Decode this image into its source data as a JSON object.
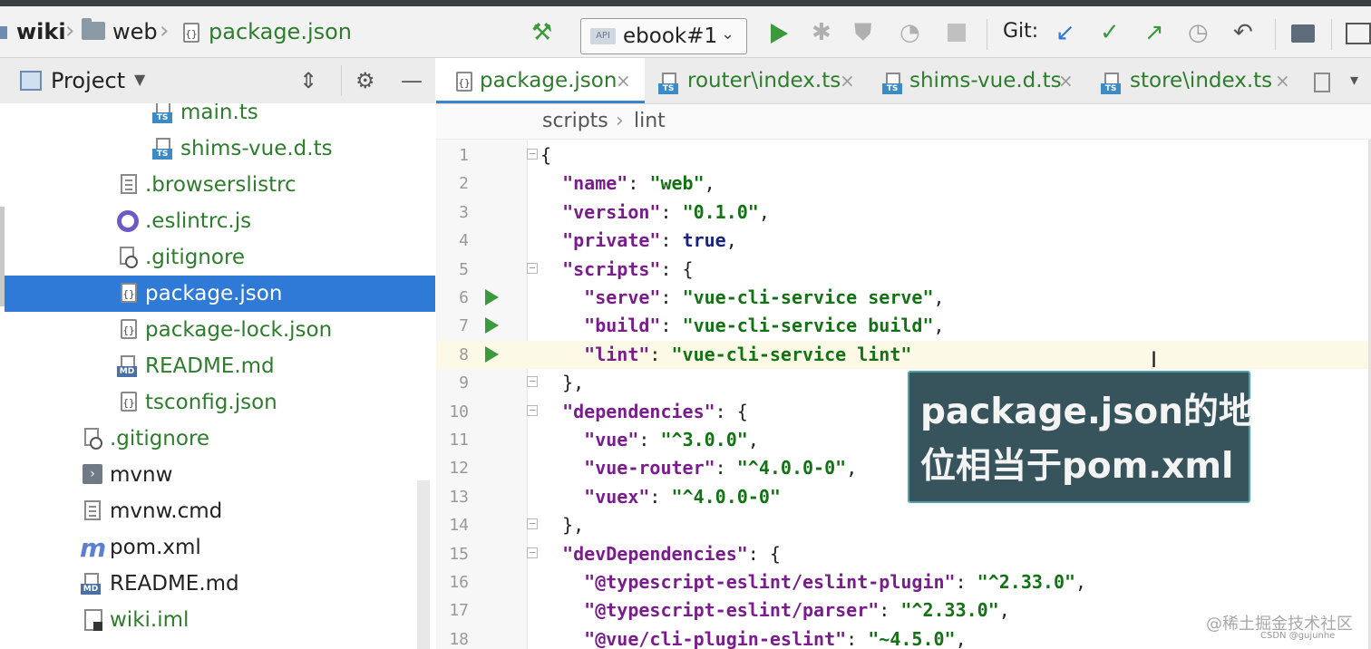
{
  "navbar": {
    "crumbs": [
      "wiki",
      "web",
      "package.json"
    ],
    "run_config": "ebook#1",
    "run_config_icon": "API",
    "git_label": "Git:"
  },
  "project_panel": {
    "title": "Project"
  },
  "tree": [
    {
      "label": "main.ts",
      "icon": "ts-file-icon",
      "color": "#2d7d2d"
    },
    {
      "label": "shims-vue.d.ts",
      "icon": "ts-file-icon",
      "color": "#2d7d2d"
    },
    {
      "label": ".browserslistrc",
      "icon": "text-file-icon",
      "color": "#2d7d2d"
    },
    {
      "label": ".eslintrc.js",
      "icon": "eslint-icon",
      "color": "#2d7d2d"
    },
    {
      "label": ".gitignore",
      "icon": "gitignore-icon",
      "color": "#2d7d2d"
    },
    {
      "label": "package.json",
      "icon": "json-file-icon",
      "color": "#ffffff",
      "selected": true
    },
    {
      "label": "package-lock.json",
      "icon": "json-file-icon",
      "color": "#2d7d2d"
    },
    {
      "label": "README.md",
      "icon": "markdown-file-icon",
      "color": "#2d7d2d"
    },
    {
      "label": "tsconfig.json",
      "icon": "json-file-icon",
      "color": "#2d7d2d"
    },
    {
      "label": ".gitignore",
      "icon": "gitignore-icon",
      "color": "#2d7d2d"
    },
    {
      "label": "mvnw",
      "icon": "terminal-file-icon",
      "color": "#222222"
    },
    {
      "label": "mvnw.cmd",
      "icon": "text-file-icon",
      "color": "#222222"
    },
    {
      "label": "pom.xml",
      "icon": "maven-icon",
      "color": "#222222"
    },
    {
      "label": "README.md",
      "icon": "markdown-file-icon",
      "color": "#222222"
    },
    {
      "label": "wiki.iml",
      "icon": "iml-file-icon",
      "color": "#2d7d2d"
    }
  ],
  "tabs": [
    {
      "label": "package.json",
      "icon": "json-file-icon",
      "active": true
    },
    {
      "label": "router\\index.ts",
      "icon": "ts-file-icon"
    },
    {
      "label": "shims-vue.d.ts",
      "icon": "ts-file-icon"
    },
    {
      "label": "store\\index.ts",
      "icon": "ts-file-icon"
    }
  ],
  "editor_breadcrumb": [
    "scripts",
    "lint"
  ],
  "code_lines": [
    {
      "n": "1",
      "html": "{",
      "fold": true
    },
    {
      "n": "2",
      "html": "  <span class=\"k\">\"name\"</span>: <span class=\"s\">\"web\"</span>,"
    },
    {
      "n": "3",
      "html": "  <span class=\"k\">\"version\"</span>: <span class=\"s\">\"0.1.0\"</span>,"
    },
    {
      "n": "4",
      "html": "  <span class=\"k\">\"private\"</span>: <span class=\"b\">true</span>,"
    },
    {
      "n": "5",
      "html": "  <span class=\"k\">\"scripts\"</span>: {",
      "fold": true
    },
    {
      "n": "6",
      "html": "    <span class=\"k\">\"serve\"</span>: <span class=\"s\">\"vue-cli-service serve\"</span>,",
      "run": true
    },
    {
      "n": "7",
      "html": "    <span class=\"k\">\"build\"</span>: <span class=\"s\">\"vue-cli-service build\"</span>,",
      "run": true
    },
    {
      "n": "8",
      "html": "    <span class=\"k\">\"lint\"</span>: <span class=\"s\">\"vue-cli-service lint\"</span>",
      "run": true,
      "highlight": true
    },
    {
      "n": "9",
      "html": "  },",
      "fold": true
    },
    {
      "n": "10",
      "html": "  <span class=\"k\">\"dependencies\"</span>: {",
      "fold": true
    },
    {
      "n": "11",
      "html": "    <span class=\"k\">\"vue\"</span>: <span class=\"s\">\"^3.0.0\"</span>,"
    },
    {
      "n": "12",
      "html": "    <span class=\"k\">\"vue-router\"</span>: <span class=\"s\">\"^4.0.0-0\"</span>,"
    },
    {
      "n": "13",
      "html": "    <span class=\"k\">\"vuex\"</span>: <span class=\"s\">\"^4.0.0-0\"</span>"
    },
    {
      "n": "14",
      "html": "  },",
      "fold": true
    },
    {
      "n": "15",
      "html": "  <span class=\"k\">\"devDependencies\"</span>: {",
      "fold": true
    },
    {
      "n": "16",
      "html": "    <span class=\"k\">\"@typescript-eslint/eslint-plugin\"</span>: <span class=\"s\">\"^2.33.0\"</span>,"
    },
    {
      "n": "17",
      "html": "    <span class=\"k\">\"@typescript-eslint/parser\"</span>: <span class=\"s\">\"^2.33.0\"</span>,"
    },
    {
      "n": "18",
      "html": "    <span class=\"k\">\"@vue/cli-plugin-eslint\"</span>: <span class=\"s\">\"~4.5.0\"</span>,"
    }
  ],
  "overlay": {
    "line1": "package.json的地",
    "line2": "位相当于pom.xml"
  },
  "watermark": {
    "line1": "@稀土掘金技术社区",
    "line2": "CSDN @gujunhe"
  },
  "colors": {
    "accent": "#2f7ad6",
    "run_green": "#3c9a3c",
    "json_key": "#7a1d8c",
    "json_string": "#137213"
  }
}
